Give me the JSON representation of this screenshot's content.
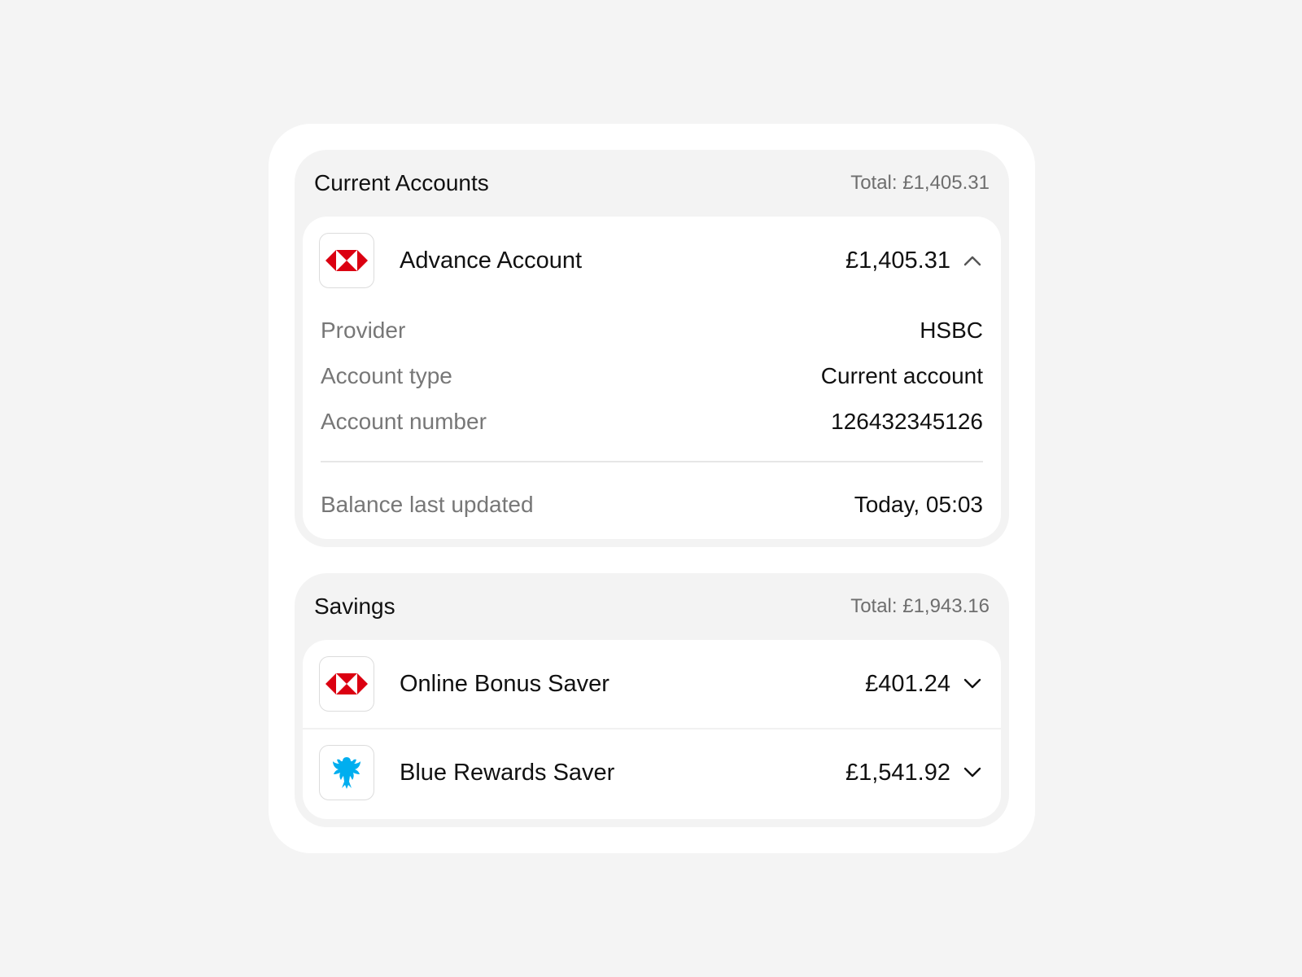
{
  "sections": {
    "current": {
      "title": "Current Accounts",
      "total": "Total: £1,405.31",
      "account": {
        "name": "Advance Account",
        "amount": "£1,405.31",
        "logo": "hsbc-logo-icon",
        "chevron": "chevron-up-icon",
        "details": [
          {
            "label": "Provider",
            "value": "HSBC"
          },
          {
            "label": "Account type",
            "value": "Current account"
          },
          {
            "label": "Account number",
            "value": "126432345126"
          }
        ],
        "updated": {
          "label": "Balance last updated",
          "value": "Today, 05:03"
        }
      }
    },
    "savings": {
      "title": "Savings",
      "total": "Total: £1,943.16",
      "accounts": [
        {
          "name": "Online Bonus Saver",
          "amount": "£401.24",
          "logo": "hsbc-logo-icon",
          "chevron": "chevron-down-icon"
        },
        {
          "name": "Blue Rewards Saver",
          "amount": "£1,541.92",
          "logo": "barclays-eagle-icon",
          "chevron": "chevron-down-icon"
        }
      ]
    }
  },
  "colors": {
    "hsbc_red": "#db0011",
    "barclays_blue": "#00aeef",
    "page_bg": "#f4f4f4",
    "section_bg": "#f3f3f3",
    "label_grey": "#777777"
  }
}
